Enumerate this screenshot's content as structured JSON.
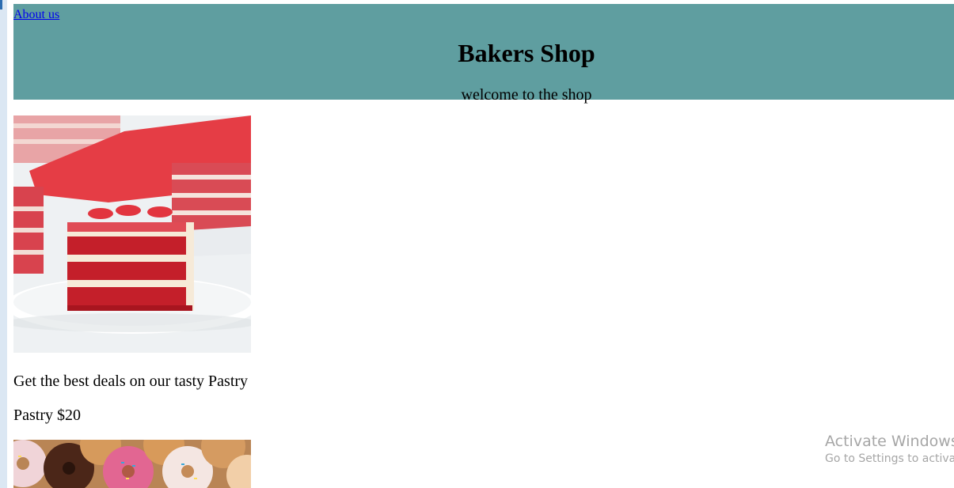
{
  "header": {
    "nav_link": "About us",
    "title": "Bakers Shop",
    "tagline": "welcome to the shop",
    "background_color": "#5f9ea0"
  },
  "products": [
    {
      "image": "red-velvet-cake-slice",
      "description": "Get the best deals on our tasty Pastry",
      "price_label": "Pastry $20"
    },
    {
      "image": "assorted-donuts"
    }
  ],
  "watermark": {
    "title": "Activate Windows",
    "subtitle": "Go to Settings to activate Windows."
  }
}
